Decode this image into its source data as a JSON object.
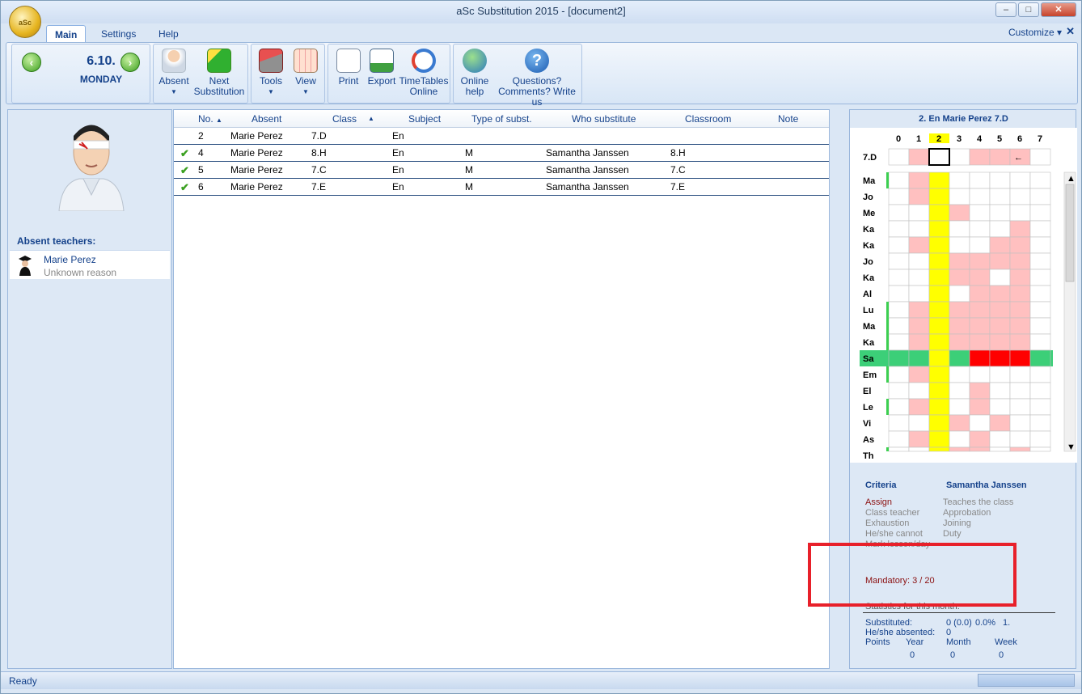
{
  "window": {
    "title": "aSc Substitution 2015  - [document2]",
    "app_logo_text": "aSc"
  },
  "tabs": [
    {
      "label": "Main"
    },
    {
      "label": "Settings"
    },
    {
      "label": "Help"
    }
  ],
  "customize": "Customize",
  "nav": {
    "date": "6.10.",
    "day": "MONDAY"
  },
  "ribbon": {
    "absent": "Absent",
    "next1": "Next",
    "next2": "Substitution",
    "tools": "Tools",
    "view": "View",
    "print": "Print",
    "export": "Export",
    "tt1": "TimeTables",
    "tt2": "Online",
    "oh1": "Online",
    "oh2": "help",
    "q1": "Questions?",
    "q2": "Comments? Write us"
  },
  "left": {
    "header": "Absent teachers:",
    "teacher": "Marie Perez",
    "reason": "Unknown reason"
  },
  "table": {
    "columns": [
      "No.",
      "Absent",
      "Class",
      "Subject",
      "Type of subst.",
      "Who substitute",
      "Classroom",
      "Note"
    ],
    "rows": [
      {
        "done": false,
        "no": "2",
        "absent": "Marie Perez",
        "class": "7.D",
        "subject": "En",
        "type": "",
        "who": "",
        "room": ""
      },
      {
        "done": true,
        "no": "4",
        "absent": "Marie Perez",
        "class": "8.H",
        "subject": "En",
        "type": "M",
        "who": "Samantha Janssen",
        "room": "8.H"
      },
      {
        "done": true,
        "no": "5",
        "absent": "Marie Perez",
        "class": "7.C",
        "subject": "En",
        "type": "M",
        "who": "Samantha Janssen",
        "room": "7.C"
      },
      {
        "done": true,
        "no": "6",
        "absent": "Marie Perez",
        "class": "7.E",
        "subject": "En",
        "type": "M",
        "who": "Samantha Janssen",
        "room": "7.E"
      }
    ]
  },
  "right": {
    "title": "2. En Marie Perez 7.D",
    "periods": [
      "0",
      "1",
      "2",
      "3",
      "4",
      "5",
      "6",
      "7"
    ],
    "class_row_label": "7.D",
    "teachers": [
      "Ma",
      "Jo",
      "Me",
      "Ka",
      "Ka",
      "Jo",
      "Ka",
      "Al",
      "Lu",
      "Ma",
      "Ka",
      "Sa",
      "Em",
      "El",
      "Le",
      "Vi",
      "As",
      "Th"
    ],
    "criteria": "Criteria",
    "candidate": "Samantha Janssen",
    "left_list": [
      "Assign",
      "Class teacher",
      "Exhaustion",
      "He/she cannot",
      "Mark lesson/day"
    ],
    "right_list": [
      "Teaches the class",
      "Approbation",
      "Joining",
      "Duty"
    ],
    "mandatory": "Mandatory: 3 / 20",
    "stats_header": "Statistics for this month:",
    "substituted_label": "Substituted:",
    "substituted_val": "0 (0.0)",
    "substituted_pct": "0.0%",
    "substituted_rank": "1.",
    "absented_label": "He/she absented:",
    "absented_val": "0",
    "points": "Points",
    "year": "Year",
    "month": "Month",
    "week": "Week",
    "year_val": "0",
    "month_val": "0",
    "week_val": "0"
  },
  "status": "Ready",
  "colors": {
    "accent": "#15428b",
    "highlight": "#ffff00",
    "busy": "#ffc0c0",
    "conflict": "#ff0000",
    "selected": "#3ccf78"
  }
}
